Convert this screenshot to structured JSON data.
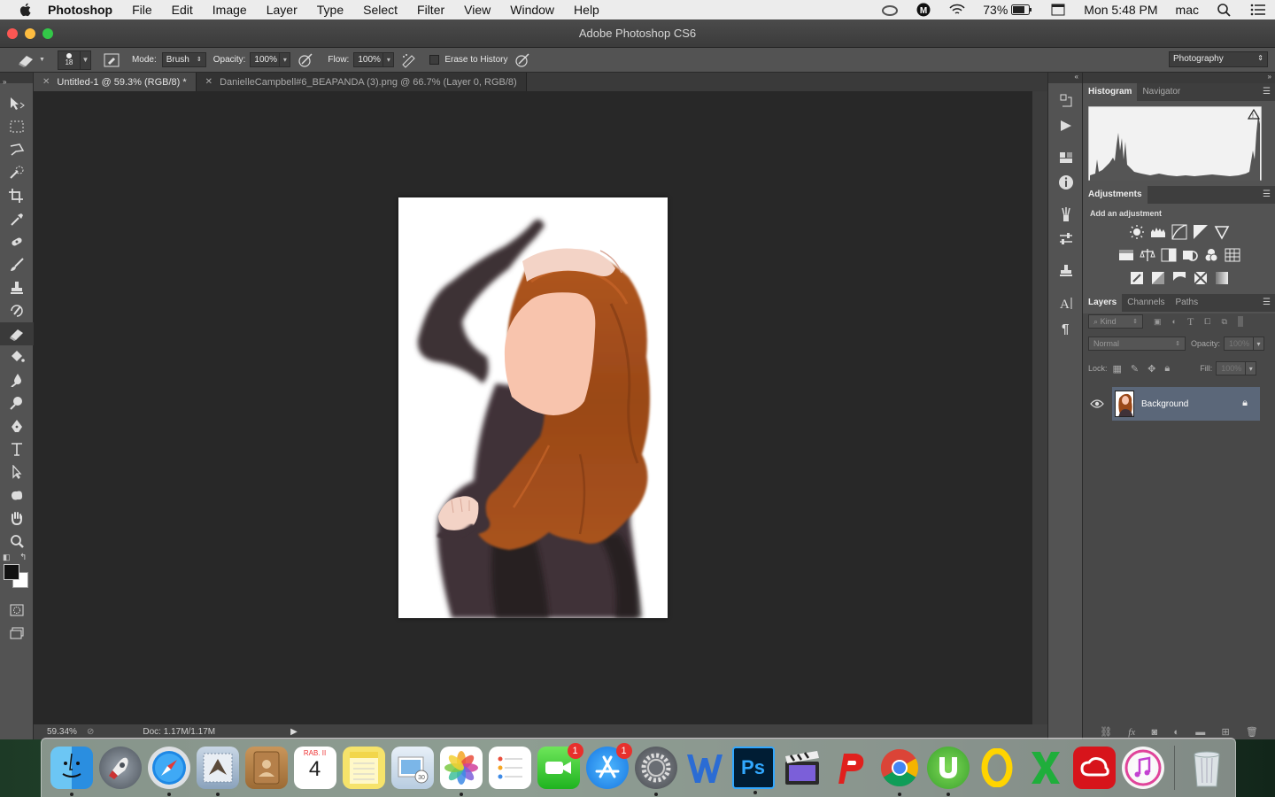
{
  "menubar": {
    "app_name": "Photoshop",
    "items": [
      "File",
      "Edit",
      "Image",
      "Layer",
      "Type",
      "Select",
      "Filter",
      "View",
      "Window",
      "Help"
    ],
    "battery": "73%",
    "clock": "Mon 5:48 PM",
    "user": "mac"
  },
  "window": {
    "title": "Adobe Photoshop CS6"
  },
  "options": {
    "brush_size": "18",
    "mode_label": "Mode:",
    "mode_value": "Brush",
    "opacity_label": "Opacity:",
    "opacity_value": "100%",
    "flow_label": "Flow:",
    "flow_value": "100%",
    "erase_history_label": "Erase to History",
    "workspace": "Photography"
  },
  "tabs": [
    {
      "label": "Untitled-1 @ 59.3% (RGB/8) *",
      "active": true
    },
    {
      "label": "DanielleCampbell#6_BEAPANDA (3).png @ 66.7% (Layer 0, RGB/8)",
      "active": false
    }
  ],
  "status": {
    "zoom": "59.34%",
    "doc": "Doc: 1.17M/1.17M"
  },
  "panels": {
    "histogram_tab": "Histogram",
    "navigator_tab": "Navigator",
    "adjustments_tab": "Adjustments",
    "add_adjustment": "Add an adjustment",
    "layers_tab": "Layers",
    "channels_tab": "Channels",
    "paths_tab": "Paths",
    "kind_label": "Kind",
    "blend_mode": "Normal",
    "opacity_label": "Opacity:",
    "opacity_value": "100%",
    "lock_label": "Lock:",
    "fill_label": "Fill:",
    "fill_value": "100%",
    "layer_name": "Background"
  },
  "dock": {
    "calendar_month": "RAB. II",
    "calendar_day": "4",
    "facetime_badge": "1",
    "appstore_badge": "1",
    "photoshop_label": "Ps"
  }
}
